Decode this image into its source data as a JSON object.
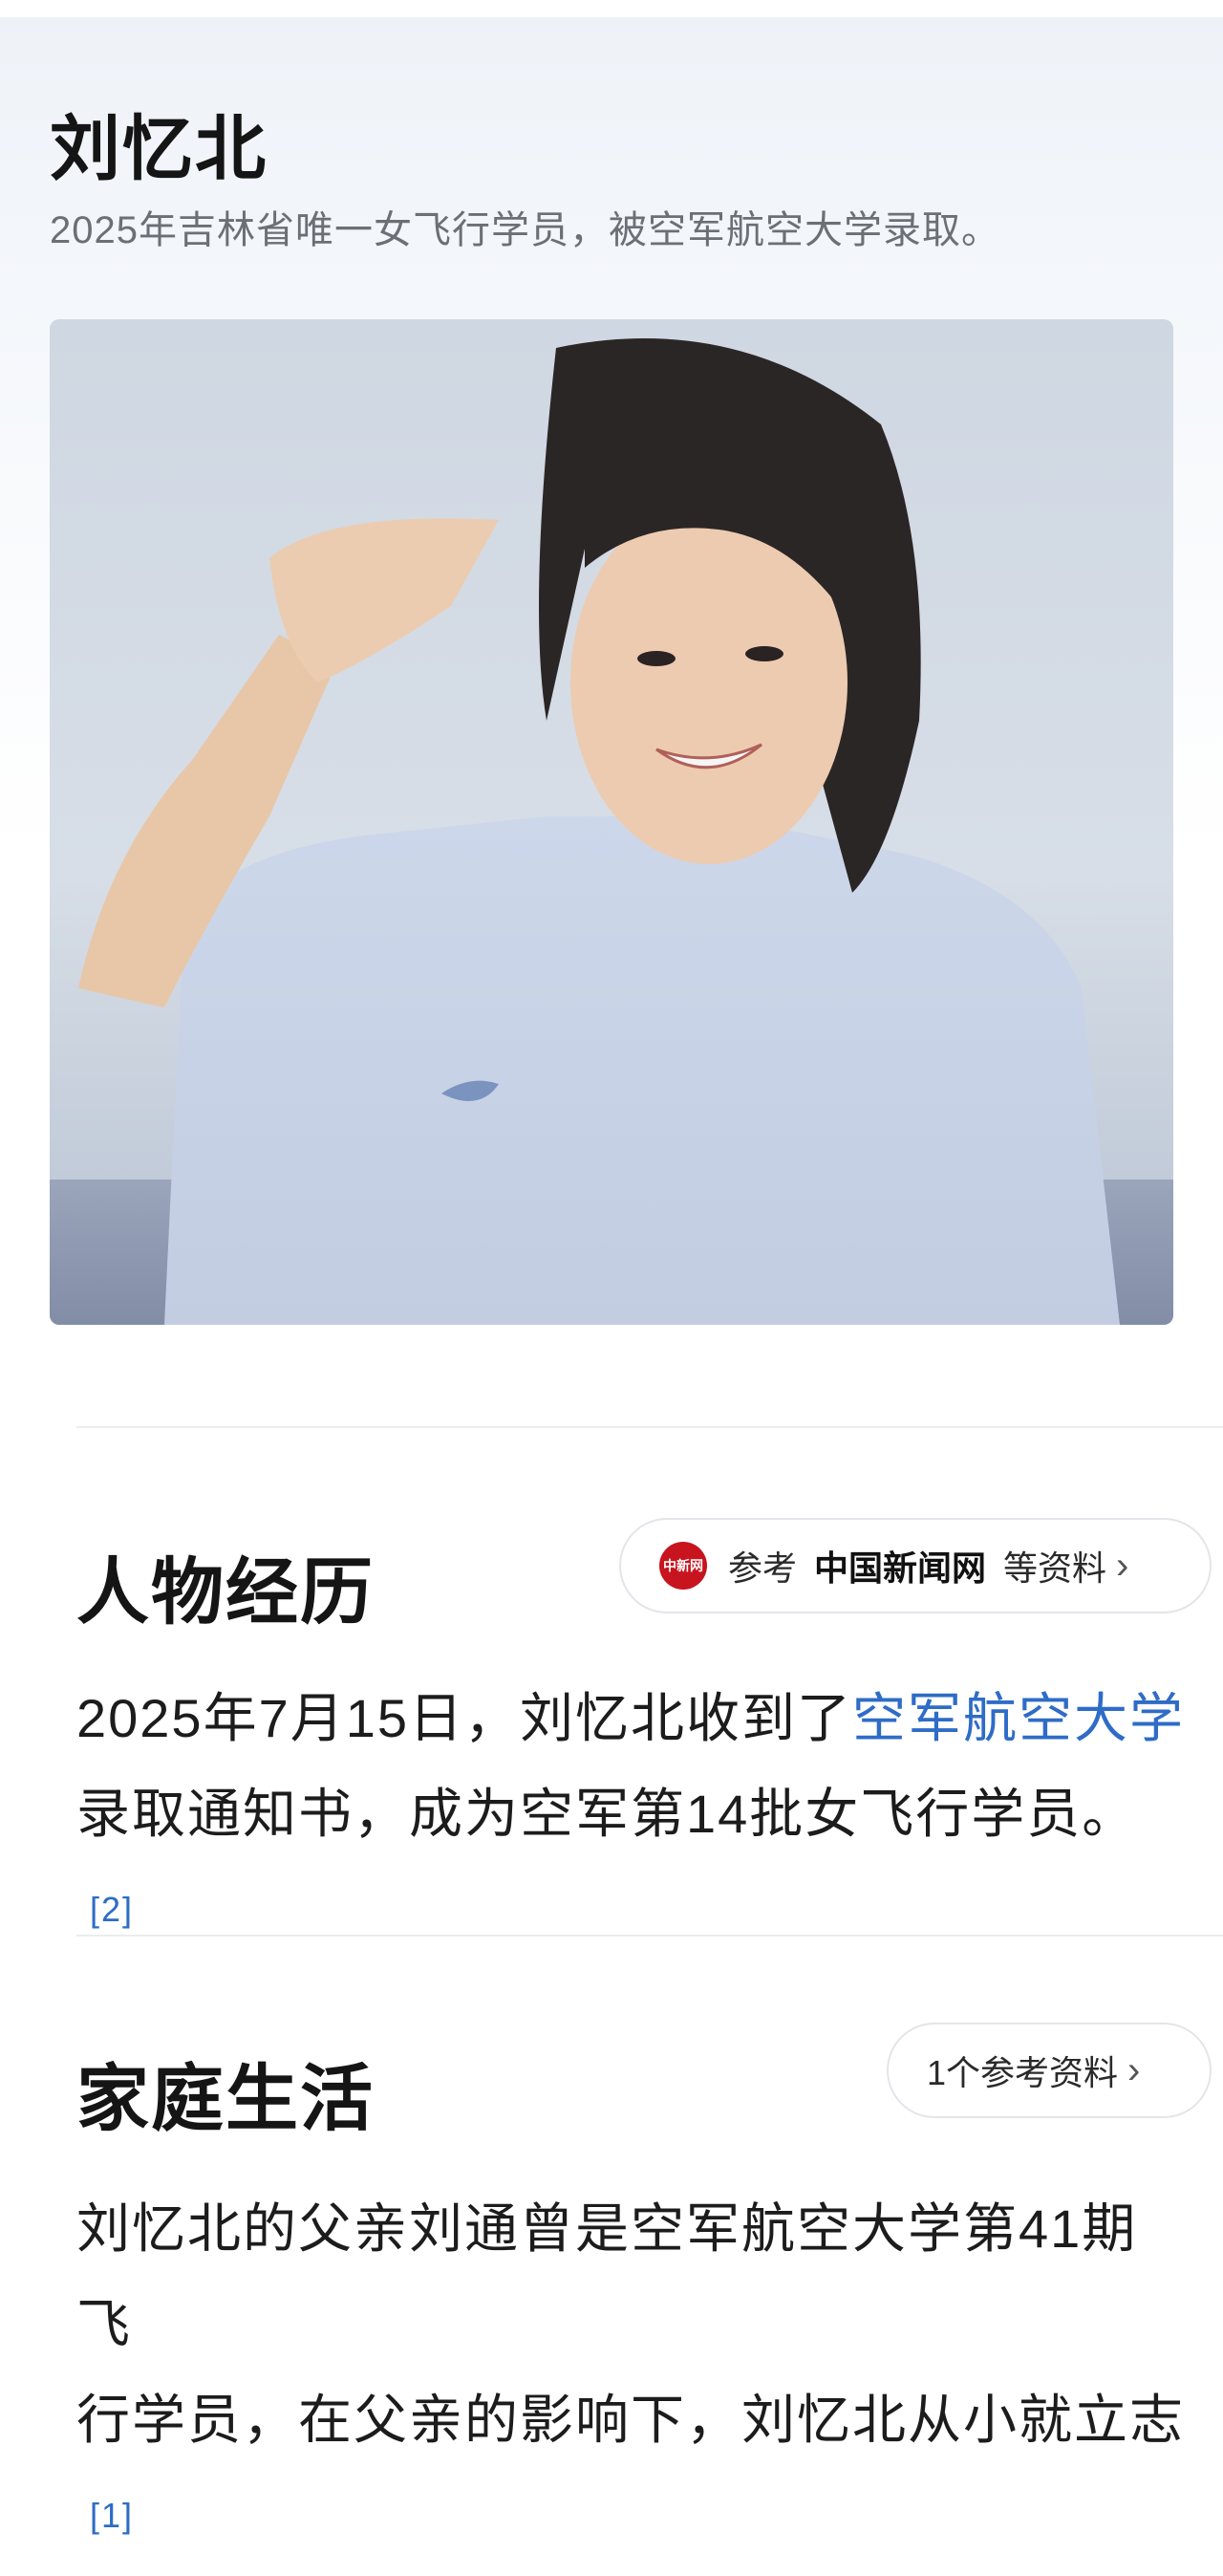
{
  "person": {
    "name": "刘忆北",
    "summary": "2025年吉林省唯一女飞行学员，被空军航空大学录取。"
  },
  "sections": {
    "experience": {
      "title": "人物经历",
      "ref": {
        "prefix": "参考",
        "source": "中国新闻网",
        "suffix": "等资料",
        "logo_text": "中新网"
      },
      "text_before": "2025年7月15日，刘忆北收到了",
      "link_text": "空军航空大学",
      "text_after": "录取通知书，成为空军第14批女飞行学员。",
      "citation": "[2]"
    },
    "family": {
      "title": "家庭生活",
      "ref": {
        "label": "1个参考资料"
      },
      "text_line1": "刘忆北的父亲刘通曾是空军航空大学第41期飞",
      "text_line2": "行学员，在父亲的影响下，刘忆北从小就立志",
      "citation": "[1]"
    }
  },
  "icons": {
    "chevron": "chevron-right-icon",
    "source_logo": "news-logo-icon"
  },
  "colors": {
    "link": "#2e6cc7",
    "logo": "#c8141e"
  }
}
